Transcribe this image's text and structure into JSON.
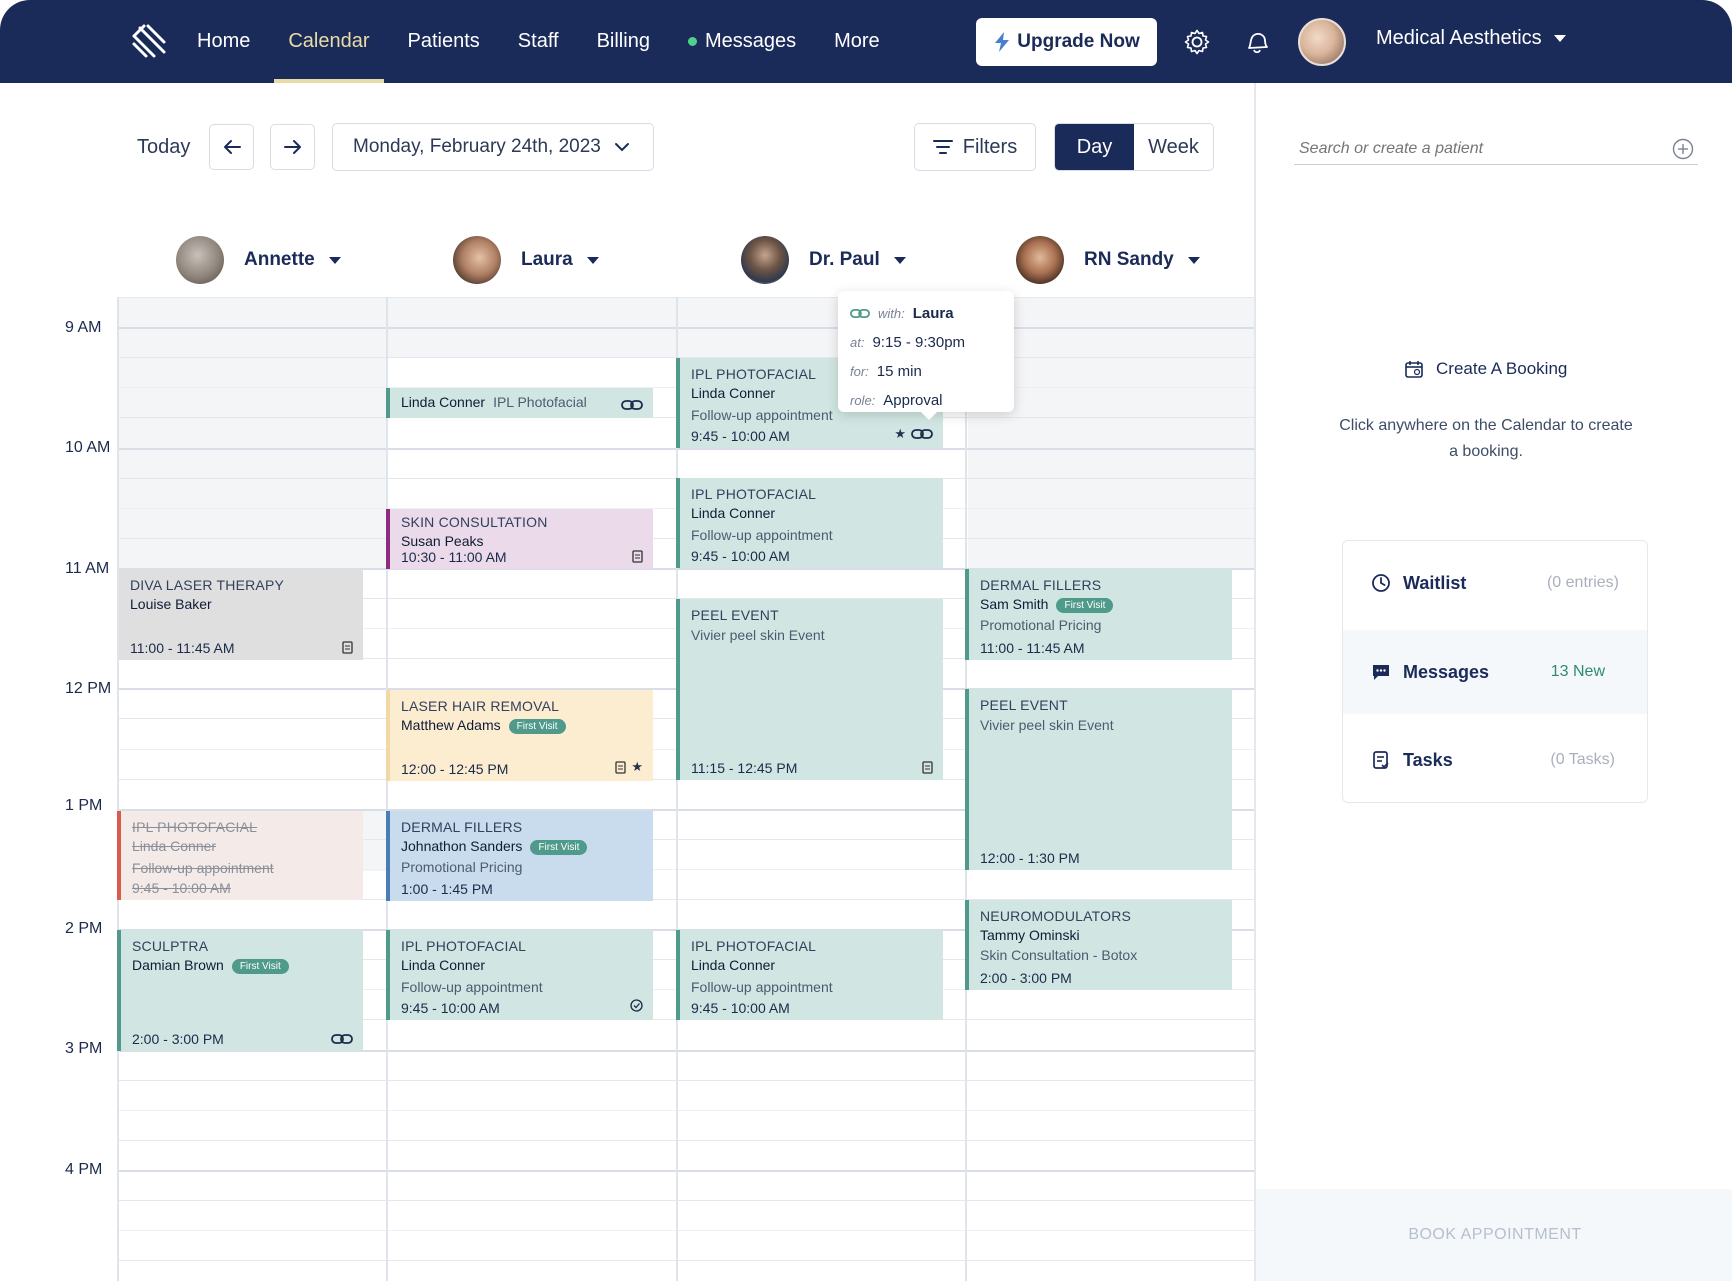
{
  "nav": {
    "links": [
      "Home",
      "Calendar",
      "Patients",
      "Staff",
      "Billing",
      "Messages",
      "More"
    ],
    "active": "Calendar",
    "upgrade_label": "Upgrade Now",
    "org_name": "Medical Aesthetics",
    "colors": {
      "bar": "#1b2b59",
      "active": "#e9dba8",
      "messages_dot": "#4fd18b"
    }
  },
  "toolbar": {
    "today_label": "Today",
    "date_label": "Monday, February 24th, 2023",
    "filters_label": "Filters",
    "view_day": "Day",
    "view_week": "Week",
    "active_view": "Day"
  },
  "staff": [
    "Annette",
    "Laura",
    "Dr. Paul",
    "RN Sandy"
  ],
  "times": [
    "9 AM",
    "10 AM",
    "11 AM",
    "12 PM",
    "1 PM",
    "2 PM",
    "3 PM",
    "4 PM"
  ],
  "appointments": {
    "a1": {
      "title": "DIVA LASER THERAPY",
      "name": "Louise Baker",
      "time": "11:00 - 11:45 AM"
    },
    "a2": {
      "title": "IPL PHOTOFACIAL",
      "name": "Linda Conner",
      "sub": "Follow-up appointment",
      "time": "9:45 - 10:00 AM",
      "status": "cancelled"
    },
    "a3": {
      "title": "SCULPTRA",
      "name": "Damian Brown",
      "badge": "First Visit",
      "time": "2:00 - 3:00 PM"
    },
    "l1": {
      "name": "Linda Conner",
      "sub": "IPL Photofacial"
    },
    "l2": {
      "title": "SKIN CONSULTATION",
      "name": "Susan Peaks",
      "time": "10:30 - 11:00 AM"
    },
    "l3": {
      "title": "LASER HAIR REMOVAL",
      "name": "Matthew Adams",
      "badge": "First Visit",
      "time": "12:00 - 12:45 PM"
    },
    "l4": {
      "title": "DERMAL FILLERS",
      "name": "Johnathon Sanders",
      "badge": "First Visit",
      "sub": "Promotional Pricing",
      "time": "1:00 - 1:45 PM"
    },
    "l5": {
      "title": "IPL PHOTOFACIAL",
      "name": "Linda Conner",
      "sub": "Follow-up appointment",
      "time": "9:45 - 10:00 AM"
    },
    "p1": {
      "title": "IPL PHOTOFACIAL",
      "name": "Linda Conner",
      "sub": "Follow-up appointment",
      "time": "9:45 - 10:00 AM"
    },
    "p2": {
      "title": "IPL PHOTOFACIAL",
      "name": "Linda Conner",
      "sub": "Follow-up appointment",
      "time": "9:45 - 10:00 AM"
    },
    "p3": {
      "title": "PEEL EVENT",
      "sub": "Vivier peel skin Event",
      "time": "11:15 - 12:45 PM"
    },
    "p4": {
      "title": "IPL PHOTOFACIAL",
      "name": "Linda Conner",
      "sub": "Follow-up appointment",
      "time": "9:45 - 10:00 AM"
    },
    "s1": {
      "title": "DERMAL FILLERS",
      "name": "Sam Smith",
      "badge": "First Visit",
      "sub": "Promotional Pricing",
      "time": "11:00 - 11:45 AM"
    },
    "s2": {
      "title": "PEEL EVENT",
      "sub": "Vivier peel skin Event",
      "time": "12:00 - 1:30 PM"
    },
    "s3": {
      "title": "NEUROMODULATORS",
      "name": "Tammy Ominski",
      "sub": "Skin Consultation - Botox",
      "time": "2:00 - 3:00 PM"
    }
  },
  "tooltip": {
    "with_key": "with:",
    "with_val": "Laura",
    "at_key": "at:",
    "at_val": "9:15 - 9:30pm",
    "for_key": "for:",
    "for_val": "15 min",
    "role_key": "role:",
    "role_val": "Approval"
  },
  "right_panel": {
    "search_placeholder": "Search or create a patient",
    "create_label": "Create A Booking",
    "hint": "Click anywhere on the Calendar to create a booking.",
    "waitlist_label": "Waitlist",
    "waitlist_meta": "(0 entries)",
    "messages_label": "Messages",
    "messages_meta": "13 New",
    "tasks_label": "Tasks",
    "tasks_meta": "(0 Tasks)",
    "book_label": "BOOK APPOINTMENT"
  }
}
